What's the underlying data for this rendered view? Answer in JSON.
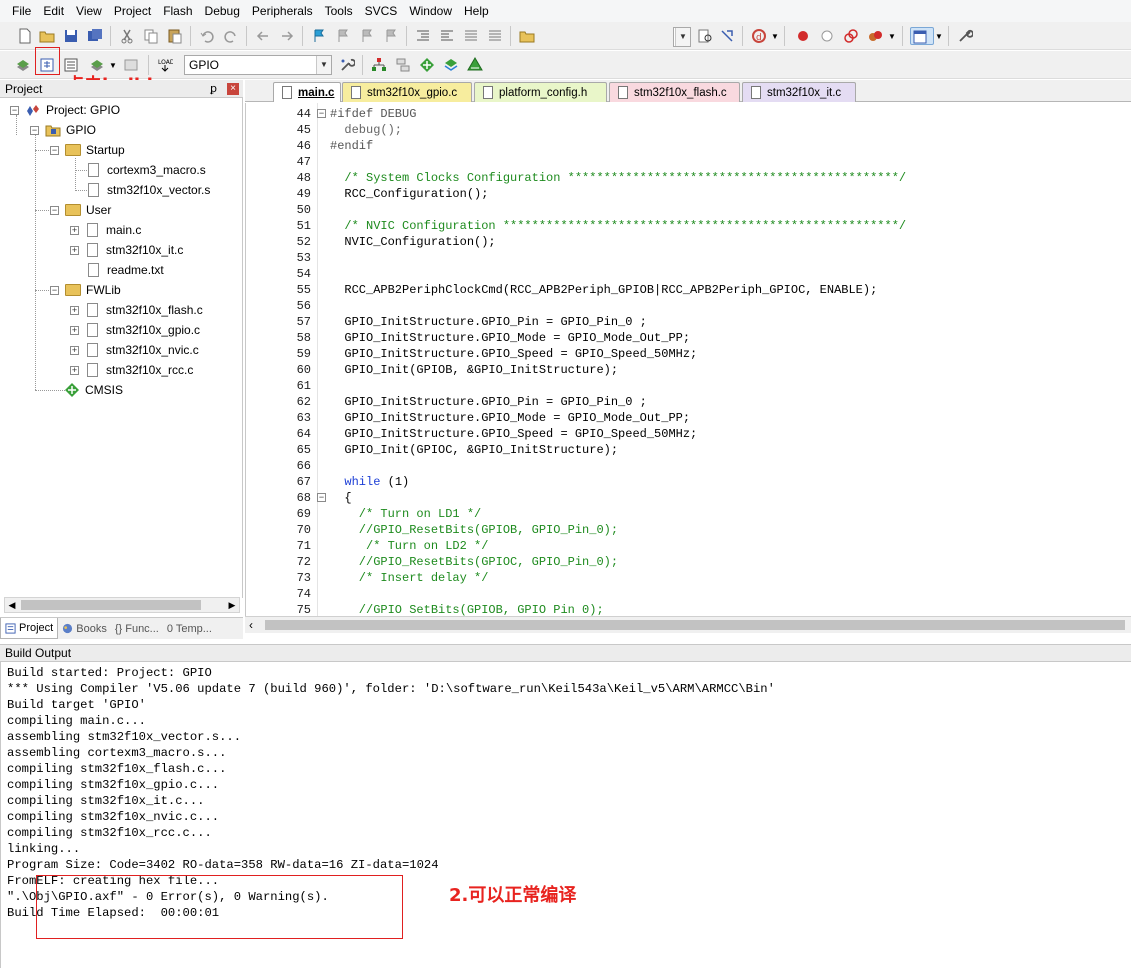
{
  "menu": [
    "File",
    "Edit",
    "View",
    "Project",
    "Flash",
    "Debug",
    "Peripherals",
    "Tools",
    "SVCS",
    "Window",
    "Help"
  ],
  "toolbar2": {
    "target_select": "GPIO"
  },
  "project_panel": {
    "title": "Project",
    "pin": "ꝑ",
    "close": "×",
    "tree": {
      "root": "Project: GPIO",
      "target": "GPIO",
      "groups": [
        {
          "name": "Startup",
          "files": [
            "cortexm3_macro.s",
            "stm32f10x_vector.s"
          ]
        },
        {
          "name": "User",
          "files": [
            "main.c",
            "stm32f10x_it.c",
            "readme.txt"
          ]
        },
        {
          "name": "FWLib",
          "files": [
            "stm32f10x_flash.c",
            "stm32f10x_gpio.c",
            "stm32f10x_nvic.c",
            "stm32f10x_rcc.c"
          ]
        },
        {
          "name": "CMSIS",
          "files": []
        }
      ]
    },
    "tabs": [
      "Project",
      "Books",
      "{} Func...",
      "0 Temp..."
    ]
  },
  "editor": {
    "tabs": [
      "main.c",
      "stm32f10x_gpio.c",
      "platform_config.h",
      "stm32f10x_flash.c",
      "stm32f10x_it.c"
    ],
    "active_tab": "main.c",
    "tab_colors": [
      "#ffffff",
      "#f7ed9e",
      "#e9f6c9",
      "#f9d9df",
      "#e4dcf3"
    ],
    "lines": [
      {
        "n": "44",
        "t": "#ifdef DEBUG"
      },
      {
        "n": "45",
        "t": "  debug();"
      },
      {
        "n": "46",
        "t": "#endif"
      },
      {
        "n": "47",
        "t": ""
      },
      {
        "n": "48",
        "t": "  /* System Clocks Configuration **********************************************/"
      },
      {
        "n": "49",
        "t": "  RCC_Configuration();"
      },
      {
        "n": "50",
        "t": ""
      },
      {
        "n": "51",
        "t": "  /* NVIC Configuration *******************************************************/"
      },
      {
        "n": "52",
        "t": "  NVIC_Configuration();"
      },
      {
        "n": "53",
        "t": ""
      },
      {
        "n": "54",
        "t": ""
      },
      {
        "n": "55",
        "t": "  RCC_APB2PeriphClockCmd(RCC_APB2Periph_GPIOB|RCC_APB2Periph_GPIOC, ENABLE);"
      },
      {
        "n": "56",
        "t": ""
      },
      {
        "n": "57",
        "t": "  GPIO_InitStructure.GPIO_Pin = GPIO_Pin_0 ;"
      },
      {
        "n": "58",
        "t": "  GPIO_InitStructure.GPIO_Mode = GPIO_Mode_Out_PP;"
      },
      {
        "n": "59",
        "t": "  GPIO_InitStructure.GPIO_Speed = GPIO_Speed_50MHz;"
      },
      {
        "n": "60",
        "t": "  GPIO_Init(GPIOB, &GPIO_InitStructure);"
      },
      {
        "n": "61",
        "t": ""
      },
      {
        "n": "62",
        "t": "  GPIO_InitStructure.GPIO_Pin = GPIO_Pin_0 ;"
      },
      {
        "n": "63",
        "t": "  GPIO_InitStructure.GPIO_Mode = GPIO_Mode_Out_PP;"
      },
      {
        "n": "64",
        "t": "  GPIO_InitStructure.GPIO_Speed = GPIO_Speed_50MHz;"
      },
      {
        "n": "65",
        "t": "  GPIO_Init(GPIOC, &GPIO_InitStructure);"
      },
      {
        "n": "66",
        "t": ""
      },
      {
        "n": "67",
        "t": "  while (1)"
      },
      {
        "n": "68",
        "t": "  {"
      },
      {
        "n": "69",
        "t": "    /* Turn on LD1 */"
      },
      {
        "n": "70",
        "t": "    //GPIO_ResetBits(GPIOB, GPIO_Pin_0);"
      },
      {
        "n": "71",
        "t": "     /* Turn on LD2 */"
      },
      {
        "n": "72",
        "t": "    //GPIO_ResetBits(GPIOC, GPIO_Pin_0);"
      },
      {
        "n": "73",
        "t": "    /* Insert delay */"
      },
      {
        "n": "74",
        "t": ""
      },
      {
        "n": "75",
        "t": "    //GPIO SetBits(GPIOB, GPIO Pin 0);"
      }
    ]
  },
  "build_output": {
    "title": "Build Output",
    "lines": [
      "Build started: Project: GPIO",
      "*** Using Compiler 'V5.06 update 7 (build 960)', folder: 'D:\\software_run\\Keil543a\\Keil_v5\\ARM\\ARMCC\\Bin'",
      "Build target 'GPIO'",
      "compiling main.c...",
      "assembling stm32f10x_vector.s...",
      "assembling cortexm3_macro.s...",
      "compiling stm32f10x_flash.c...",
      "compiling stm32f10x_gpio.c...",
      "compiling stm32f10x_it.c...",
      "compiling stm32f10x_nvic.c...",
      "compiling stm32f10x_rcc.c...",
      "linking...",
      "Program Size: Code=3402 RO-data=358 RW-data=16 ZI-data=1024",
      "FromELF: creating hex file...",
      "\".\\Obj\\GPIO.axf\" - 0 Error(s), 0 Warning(s).",
      "Build Time Elapsed:  00:00:01"
    ]
  },
  "annotations": {
    "build_hint": "点击build",
    "compile_ok": "2.可以正常编译"
  },
  "colors": {
    "annotation_red": "#e8231f",
    "comment_green": "#1e8b1e",
    "keyword_blue": "#1d3fd6"
  }
}
